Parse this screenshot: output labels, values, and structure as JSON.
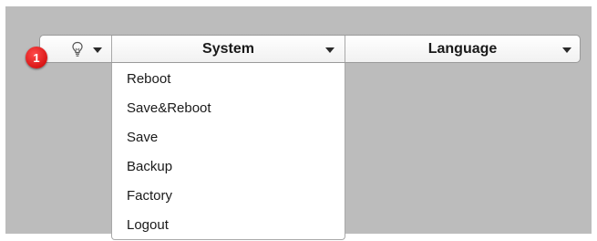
{
  "toolbar": {
    "notification_count": "1",
    "system_label": "System",
    "language_label": "Language"
  },
  "system_menu": {
    "items": [
      {
        "label": "Reboot"
      },
      {
        "label": "Save&Reboot"
      },
      {
        "label": "Save"
      },
      {
        "label": "Backup"
      },
      {
        "label": "Factory"
      },
      {
        "label": "Logout"
      }
    ]
  },
  "icons": {
    "notifications": "lightbulb-icon",
    "dropdown": "caret-down-icon"
  }
}
